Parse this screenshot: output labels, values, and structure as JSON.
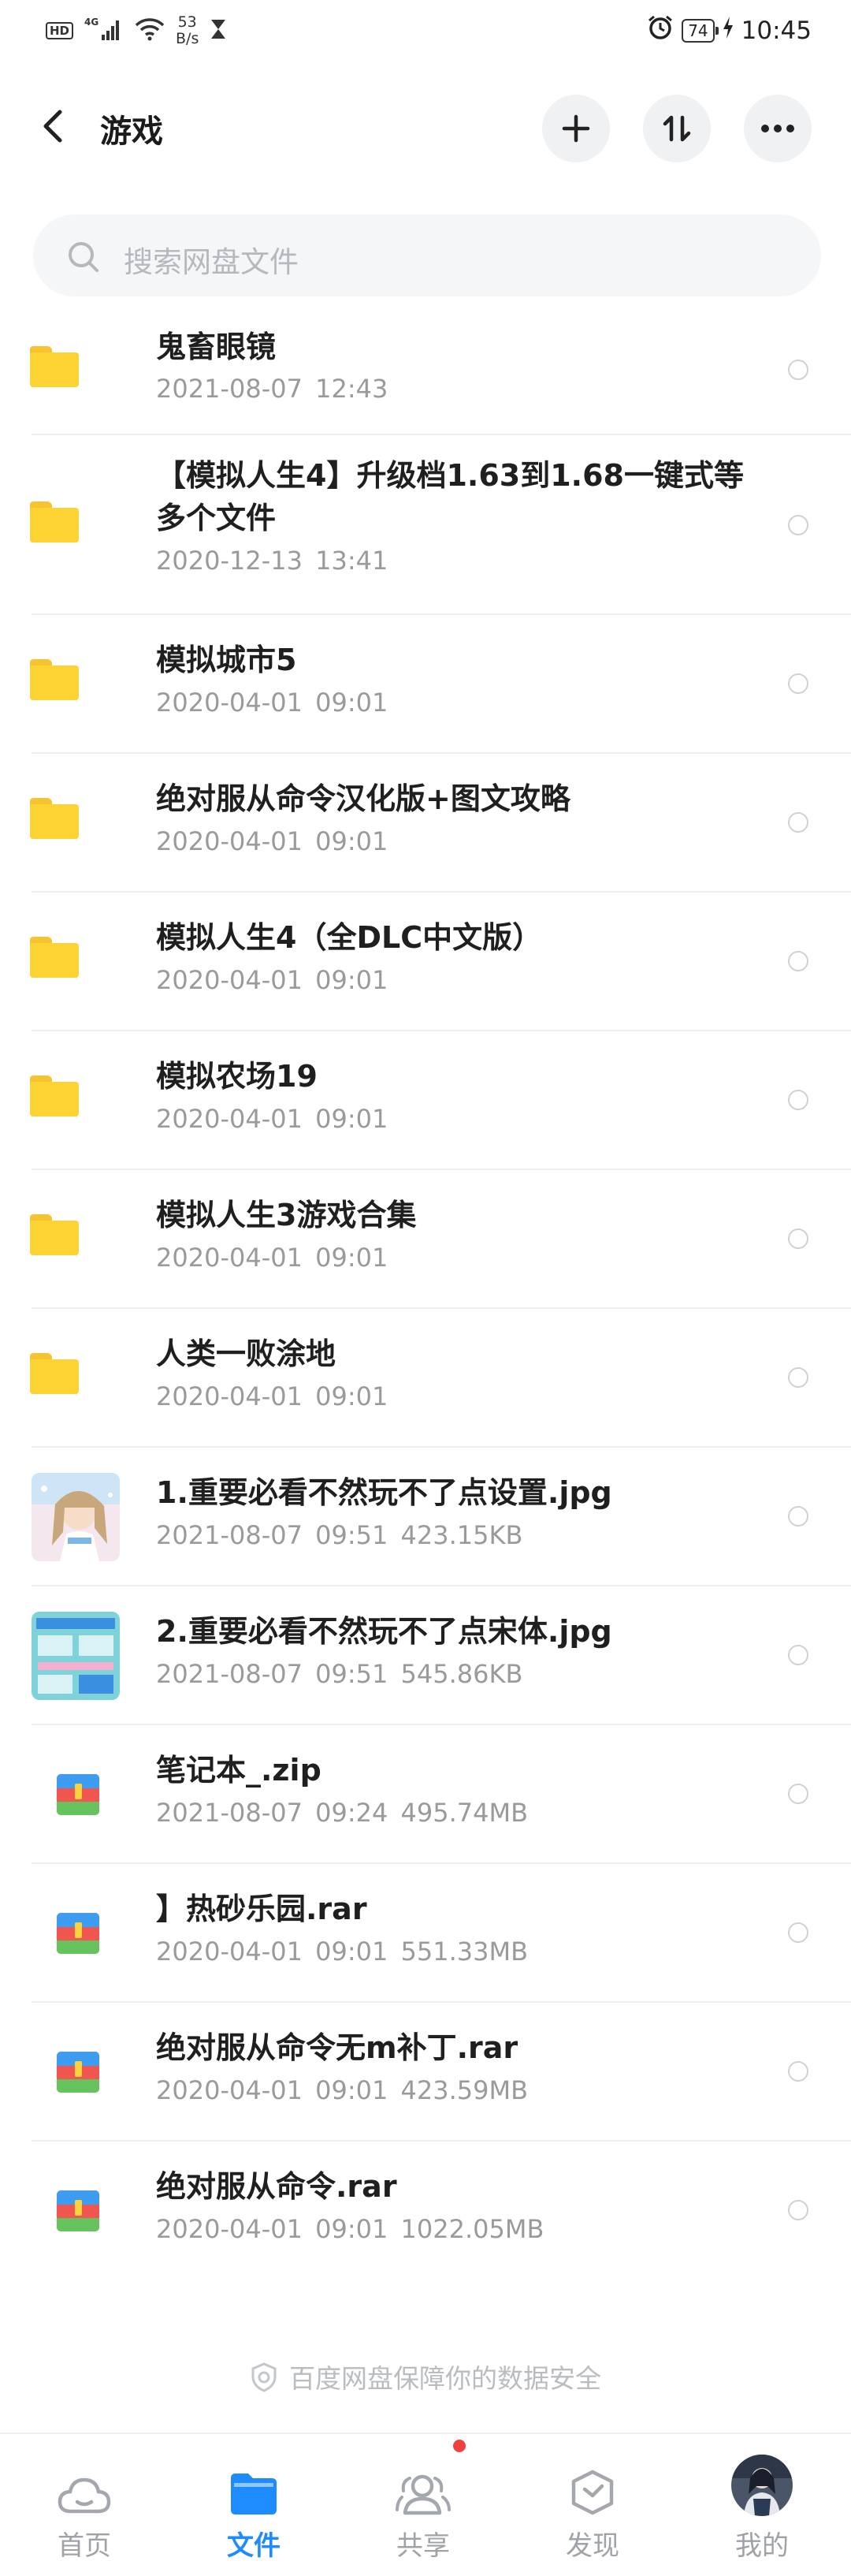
{
  "status_bar": {
    "hd": "HD",
    "network": "4G",
    "speed_value": "53",
    "speed_unit": "B/s",
    "battery": "74",
    "time": "10:45"
  },
  "header": {
    "title": "游戏"
  },
  "search": {
    "placeholder": "搜索网盘文件"
  },
  "files": [
    {
      "name": "鬼畜眼镜",
      "meta": "2021-08-07  12:43",
      "type": "folder"
    },
    {
      "name": "【模拟人生4】升级档1.63到1.68一键式等多个文件",
      "meta": "2020-12-13  13:41",
      "type": "folder"
    },
    {
      "name": "模拟城市5",
      "meta": "2020-04-01  09:01",
      "type": "folder"
    },
    {
      "name": "绝对服从命令汉化版+图文攻略",
      "meta": "2020-04-01  09:01",
      "type": "folder"
    },
    {
      "name": "模拟人生4（全DLC中文版）",
      "meta": "2020-04-01  09:01",
      "type": "folder"
    },
    {
      "name": "模拟农场19",
      "meta": "2020-04-01  09:01",
      "type": "folder"
    },
    {
      "name": "模拟人生3游戏合集",
      "meta": "2020-04-01  09:01",
      "type": "folder"
    },
    {
      "name": "人类一败涂地",
      "meta": "2020-04-01  09:01",
      "type": "folder"
    },
    {
      "name": "1.重要必看不然玩不了点设置.jpg",
      "meta": "2021-08-07  09:51  423.15KB",
      "type": "image"
    },
    {
      "name": "2.重要必看不然玩不了点宋体.jpg",
      "meta": "2021-08-07  09:51  545.86KB",
      "type": "image"
    },
    {
      "name": "笔记本_.zip",
      "meta": "2021-08-07  09:24  495.74MB",
      "type": "zip"
    },
    {
      "name": "】热砂乐园.rar",
      "meta": "2020-04-01  09:01  551.33MB",
      "type": "zip"
    },
    {
      "name": "绝对服从命令无m补丁.rar",
      "meta": "2020-04-01  09:01  423.59MB",
      "type": "zip"
    },
    {
      "name": "绝对服从命令.rar",
      "meta": "2020-04-01  09:01  1022.05MB",
      "type": "zip"
    }
  ],
  "footer_note": "百度网盘保障你的数据安全",
  "tabs": [
    {
      "label": "首页"
    },
    {
      "label": "文件"
    },
    {
      "label": "共享"
    },
    {
      "label": "发现"
    },
    {
      "label": "我的"
    }
  ],
  "colors": {
    "accent": "#1e8cff",
    "folder": "#fdd233",
    "badge": "#f04040"
  }
}
